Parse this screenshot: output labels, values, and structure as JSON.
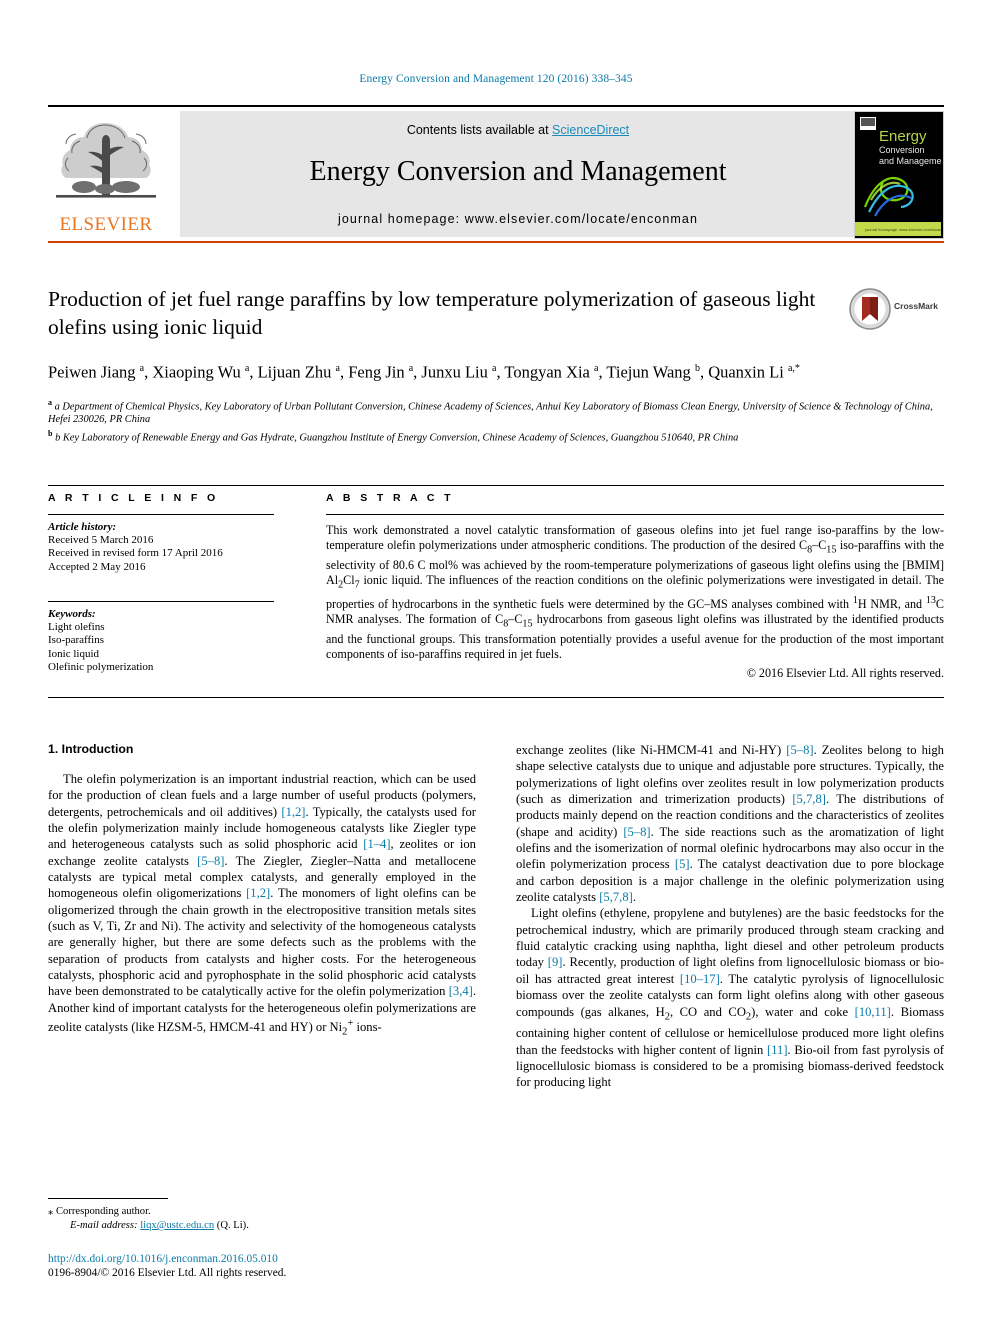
{
  "running_head": "Energy Conversion and Management 120 (2016) 338–345",
  "masthead": {
    "contents_prefix": "Contents lists available at ",
    "sciencedirect": "ScienceDirect",
    "journal_title": "Energy Conversion and Management",
    "homepage": "journal homepage: www.elsevier.com/locate/enconman",
    "publisher_logo_word": "ELSEVIER",
    "cover_title_main": "Energy",
    "cover_title_sub1": "Conversion",
    "cover_title_sub2": "and Management",
    "colors": {
      "link": "#1a8bbd",
      "running_head": "#0b7aa8",
      "elsevier_orange": "#e87722",
      "rule_orange": "#d24000",
      "banner_bg": "#e6e6e6"
    }
  },
  "article": {
    "title": "Production of jet fuel range paraffins by low temperature polymerization of gaseous light olefins using ionic liquid",
    "crossmark_label": "CrossMark",
    "authors_html": "Peiwen Jiang <sup>a</sup>, Xiaoping Wu <sup>a</sup>, Lijuan Zhu <sup>a</sup>, Feng Jin <sup>a</sup>, Junxu Liu <sup>a</sup>, Tongyan Xia <sup>a</sup>, Tiejun Wang <sup>b</sup>, Quanxin Li <sup>a,*</sup>",
    "affiliations": [
      "a Department of Chemical Physics, Key Laboratory of Urban Pollutant Conversion, Chinese Academy of Sciences, Anhui Key Laboratory of Biomass Clean Energy, University of Science & Technology of China, Hefei 230026, PR China",
      "b Key Laboratory of Renewable Energy and Gas Hydrate, Guangzhou Institute of Energy Conversion, Chinese Academy of Sciences, Guangzhou 510640, PR China"
    ]
  },
  "article_info": {
    "heading": "A R T I C L E    I N F O",
    "history_label": "Article history:",
    "history": [
      "Received 5 March 2016",
      "Received in revised form 17 April 2016",
      "Accepted 2 May 2016"
    ],
    "keywords_label": "Keywords:",
    "keywords": [
      "Light olefins",
      "Iso-paraffins",
      "Ionic liquid",
      "Olefinic polymerization"
    ]
  },
  "abstract": {
    "heading": "A B S T R A C T",
    "text_html": "This work demonstrated a novel catalytic transformation of gaseous olefins into jet fuel range iso-paraffins by the low-temperature olefin polymerizations under atmospheric conditions. The production of the desired C<sub>8</sub>&ndash;C<sub>15</sub> iso-paraffins with the selectivity of 80.6 C mol% was achieved by the room-temperature polymerizations of gaseous light olefins using the [BMIM] Al<sub>2</sub>Cl<sub>7</sub> ionic liquid. The influences of the reaction conditions on the olefinic polymerizations were investigated in detail. The properties of hydrocarbons in the synthetic fuels were determined by the GC&ndash;MS analyses combined with <sup>1</sup>H NMR, and <sup>13</sup>C NMR analyses. The formation of C<sub>8</sub>&ndash;C<sub>15</sub> hydrocarbons from gaseous light olefins was illustrated by the identified products and the functional groups. This transformation potentially provides a useful avenue for the production of the most important components of iso-paraffins required in jet fuels.",
    "copyright": "© 2016 Elsevier Ltd. All rights reserved."
  },
  "body": {
    "section_heading": "1. Introduction",
    "left_paragraphs_html": [
      "The olefin polymerization is an important industrial reaction, which can be used for the production of clean fuels and a large number of useful products (polymers, detergents, petrochemicals and oil additives) <span class=\"ref\">[1,2]</span>. Typically, the catalysts used for the olefin polymerization mainly include homogeneous catalysts like Ziegler type and heterogeneous catalysts such as solid phosphoric acid <span class=\"ref\">[1&ndash;4]</span>, zeolites or ion exchange zeolite catalysts <span class=\"ref\">[5&ndash;8]</span>. The Ziegler, Ziegler&ndash;Natta and metallocene catalysts are typical metal complex catalysts, and generally employed in the homogeneous olefin oligomerizations <span class=\"ref\">[1,2]</span>. The monomers of light olefins can be oligomerized through the chain growth in the electropositive transition metals sites (such as V, Ti, Zr and Ni). The activity and selectivity of the homogeneous catalysts are generally higher, but there are some defects such as the problems with the separation of products from catalysts and higher costs. For the heterogeneous catalysts, phosphoric acid and pyrophosphate in the solid phosphoric acid catalysts have been demonstrated to be catalytically active for the olefin polymerization <span class=\"ref\">[3,4]</span>. Another kind of important catalysts for the heterogeneous olefin polymerizations are zeolite catalysts (like HZSM-5, HMCM-41 and HY) or Ni<sub>2</sub><sup>+</sup> ions-"
    ],
    "right_paragraphs_html": [
      "exchange zeolites (like Ni-HMCM-41 and Ni-HY) <span class=\"ref\">[5&ndash;8]</span>. Zeolites belong to high shape selective catalysts due to unique and adjustable pore structures. Typically, the polymerizations of light olefins over zeolites result in low polymerization products (such as dimerization and trimerization products) <span class=\"ref\">[5,7,8]</span>. The distributions of products mainly depend on the reaction conditions and the characteristics of zeolites (shape and acidity) <span class=\"ref\">[5&ndash;8]</span>. The side reactions such as the aromatization of light olefins and the isomerization of normal olefinic hydrocarbons may also occur in the olefin polymerization process <span class=\"ref\">[5]</span>. The catalyst deactivation due to pore blockage and carbon deposition is a major challenge in the olefinic polymerization using zeolite catalysts <span class=\"ref\">[5,7,8]</span>.",
      "Light olefins (ethylene, propylene and butylenes) are the basic feedstocks for the petrochemical industry, which are primarily produced through steam cracking and fluid catalytic cracking using naphtha, light diesel and other petroleum products today <span class=\"ref\">[9]</span>. Recently, production of light olefins from lignocellulosic biomass or bio-oil has attracted great interest <span class=\"ref\">[10&ndash;17]</span>. The catalytic pyrolysis of lignocellulosic biomass over the zeolite catalysts can form light olefins along with other gaseous compounds (gas alkanes, H<sub>2</sub>, CO and CO<sub>2</sub>), water and coke <span class=\"ref\">[10,11]</span>. Biomass containing higher content of cellulose or hemicellulose produced more light olefins than the feedstocks with higher content of lignin <span class=\"ref\">[11]</span>. Bio-oil from fast pyrolysis of lignocellulosic biomass is considered to be a promising biomass-derived feedstock for producing light"
    ]
  },
  "footnote": {
    "corresponding_marker": "⁎",
    "corresponding_text": "Corresponding author.",
    "email_label": "E-mail address:",
    "email": "liqx@ustc.edu.cn",
    "email_suffix": "(Q. Li)."
  },
  "publication": {
    "doi": "http://dx.doi.org/10.1016/j.enconman.2016.05.010",
    "issn_line": "0196-8904/© 2016 Elsevier Ltd. All rights reserved."
  }
}
